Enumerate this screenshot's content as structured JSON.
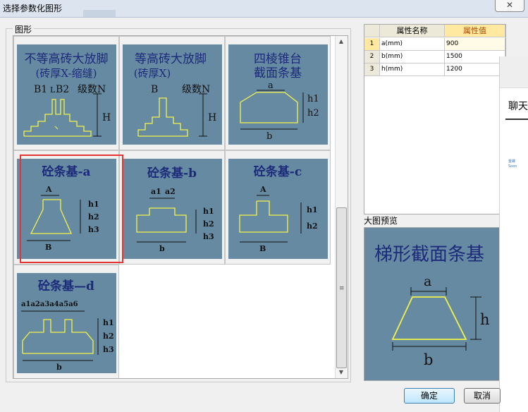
{
  "window": {
    "title": "选择参数化图形",
    "close_label": "✕"
  },
  "group": {
    "label": "图形"
  },
  "shapes": [
    {
      "title_l1": "不等高砖大放脚",
      "title_l2": "(砖厚X-缩缝)",
      "b1": "B1",
      "l": "L",
      "b2": "B2",
      "level": "级数N",
      "h": "H"
    },
    {
      "title_l1": "等高砖大放脚",
      "title_l2": "(砖厚X)",
      "b": "B",
      "level": "级数N",
      "h": "H"
    },
    {
      "title_l1": "四棱锥台",
      "title_l2": "截面条基",
      "a": "a",
      "b": "b",
      "h1": "h1",
      "h2": "h2"
    },
    {
      "title": "砼条基-a",
      "a": "A",
      "b": "B",
      "h1": "h1",
      "h2": "h2",
      "h3": "h3"
    },
    {
      "title": "砼条基-b",
      "a1": "a1",
      "a2": "a2",
      "b": "b",
      "h1": "h1",
      "h2": "h2",
      "h3": "h3"
    },
    {
      "title": "砼条基-c",
      "a": "A",
      "b": "B",
      "h1": "h1",
      "h2": "h2"
    },
    {
      "title": "砼条基—d",
      "a_seq": "a1a2a3a4a5a6",
      "b": "b",
      "h1": "h1",
      "h2": "h2",
      "h3": "h3"
    }
  ],
  "properties": {
    "col_name": "属性名称",
    "col_value": "属性值",
    "rows": [
      {
        "idx": "1",
        "name": "a(mm)",
        "value": "900"
      },
      {
        "idx": "2",
        "name": "b(mm)",
        "value": "1500"
      },
      {
        "idx": "3",
        "name": "h(mm)",
        "value": "1200"
      }
    ]
  },
  "preview": {
    "label": "大图预览",
    "title": "梯形截面条基",
    "a": "a",
    "b": "b",
    "h": "h"
  },
  "chat": {
    "title": "聊天",
    "logo": "金蝶 Soon"
  },
  "buttons": {
    "ok": "确定",
    "cancel": "取消"
  },
  "scroll": {
    "grip": "≡",
    "up": "▲",
    "down": "▼"
  },
  "colors": {
    "thumb_bg": "#678aa3",
    "title_text": "#1c2a7a",
    "line": "#f2f24a",
    "selection": "#e53535"
  }
}
